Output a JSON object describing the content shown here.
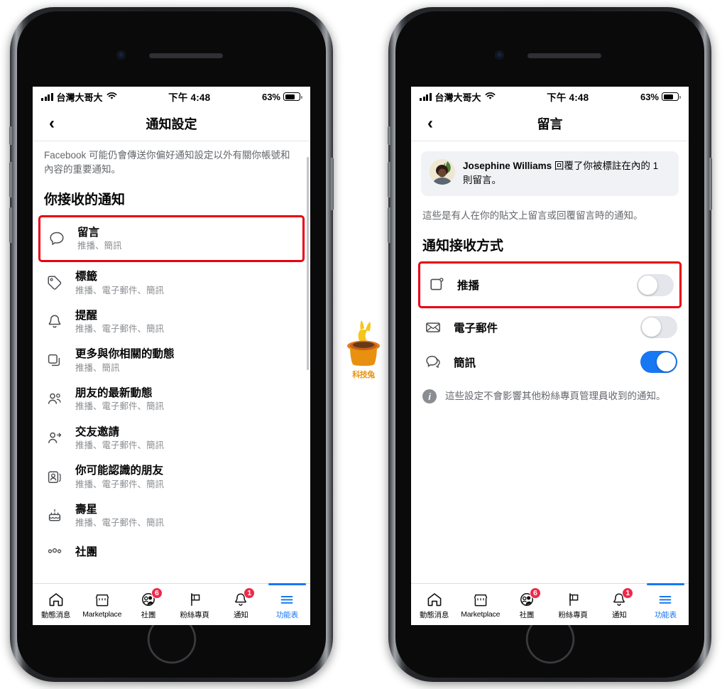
{
  "watermark": {
    "text": "科技兔",
    "icon": "rabbit-in-hat-logo",
    "color": "#e8920f"
  },
  "status_bar": {
    "carrier": "台灣大哥大",
    "time": "下午 4:48",
    "battery_percent": "63%",
    "signal_icon": "cellular-signal-icon",
    "wifi_icon": "wifi-icon",
    "battery_icon": "battery-icon"
  },
  "colors": {
    "accent": "#1877f2",
    "highlight_box": "#e8000d",
    "badge": "#f02849",
    "secondary_text": "#65676b",
    "muted_text": "#8a8d91",
    "card_bg": "#f0f2f5"
  },
  "left_phone": {
    "nav": {
      "back_icon": "chevron-left-icon",
      "title": "通知設定"
    },
    "blurb": "Facebook 可能仍會傳送你偏好通知設定以外有關你帳號和內容的重要通知。",
    "section_title": "你接收的通知",
    "items": [
      {
        "icon": "comment-bubble-icon",
        "title": "留言",
        "subtitle": "推播、簡訊",
        "highlighted": true
      },
      {
        "icon": "tag-icon",
        "title": "標籤",
        "subtitle": "推播、電子郵件、簡訊",
        "highlighted": false
      },
      {
        "icon": "bell-icon",
        "title": "提醒",
        "subtitle": "推播、電子郵件、簡訊",
        "highlighted": false
      },
      {
        "icon": "copy-stack-icon",
        "title": "更多與你相關的動態",
        "subtitle": "推播、簡訊",
        "highlighted": false
      },
      {
        "icon": "friends-icon",
        "title": "朋友的最新動態",
        "subtitle": "推播、電子郵件、簡訊",
        "highlighted": false
      },
      {
        "icon": "friend-request-icon",
        "title": "交友邀請",
        "subtitle": "推播、電子郵件、簡訊",
        "highlighted": false
      },
      {
        "icon": "people-you-may-know-icon",
        "title": "你可能認識的朋友",
        "subtitle": "推播、電子郵件、簡訊",
        "highlighted": false
      },
      {
        "icon": "birthday-cake-icon",
        "title": "壽星",
        "subtitle": "推播、電子郵件、簡訊",
        "highlighted": false
      },
      {
        "icon": "groups-icon",
        "title": "社團",
        "subtitle": "",
        "highlighted": false
      }
    ]
  },
  "right_phone": {
    "nav": {
      "back_icon": "chevron-left-icon",
      "title": "留言"
    },
    "notification_preview": {
      "avatar_icon": "user-avatar",
      "actor": "Josephine Williams",
      "text_after_actor": " 回覆了你被標註在內的 1 則留言。"
    },
    "description": "這些是有人在你的貼文上留言或回覆留言時的通知。",
    "section_title": "通知接收方式",
    "toggles": [
      {
        "icon": "push-notification-icon",
        "label": "推播",
        "on": false,
        "highlighted": true
      },
      {
        "icon": "envelope-icon",
        "label": "電子郵件",
        "on": false,
        "highlighted": false
      },
      {
        "icon": "sms-bubbles-icon",
        "label": "簡訊",
        "on": true,
        "highlighted": false
      }
    ],
    "info_note": {
      "icon": "info-icon",
      "text": "這些設定不會影響其他粉絲專頁管理員收到的通知。"
    }
  },
  "tab_bar": {
    "tabs": [
      {
        "icon": "home-icon",
        "label": "動態消息",
        "badge": "",
        "active": false
      },
      {
        "icon": "marketplace-store-icon",
        "label": "Marketplace",
        "badge": "",
        "active": false
      },
      {
        "icon": "groups-icon",
        "label": "社團",
        "badge": "6",
        "active": false
      },
      {
        "icon": "pages-flag-icon",
        "label": "粉絲專頁",
        "badge": "",
        "active": false
      },
      {
        "icon": "bell-icon",
        "label": "通知",
        "badge": "1",
        "active": false
      },
      {
        "icon": "hamburger-menu-icon",
        "label": "功能表",
        "badge": "",
        "active": true
      }
    ]
  }
}
